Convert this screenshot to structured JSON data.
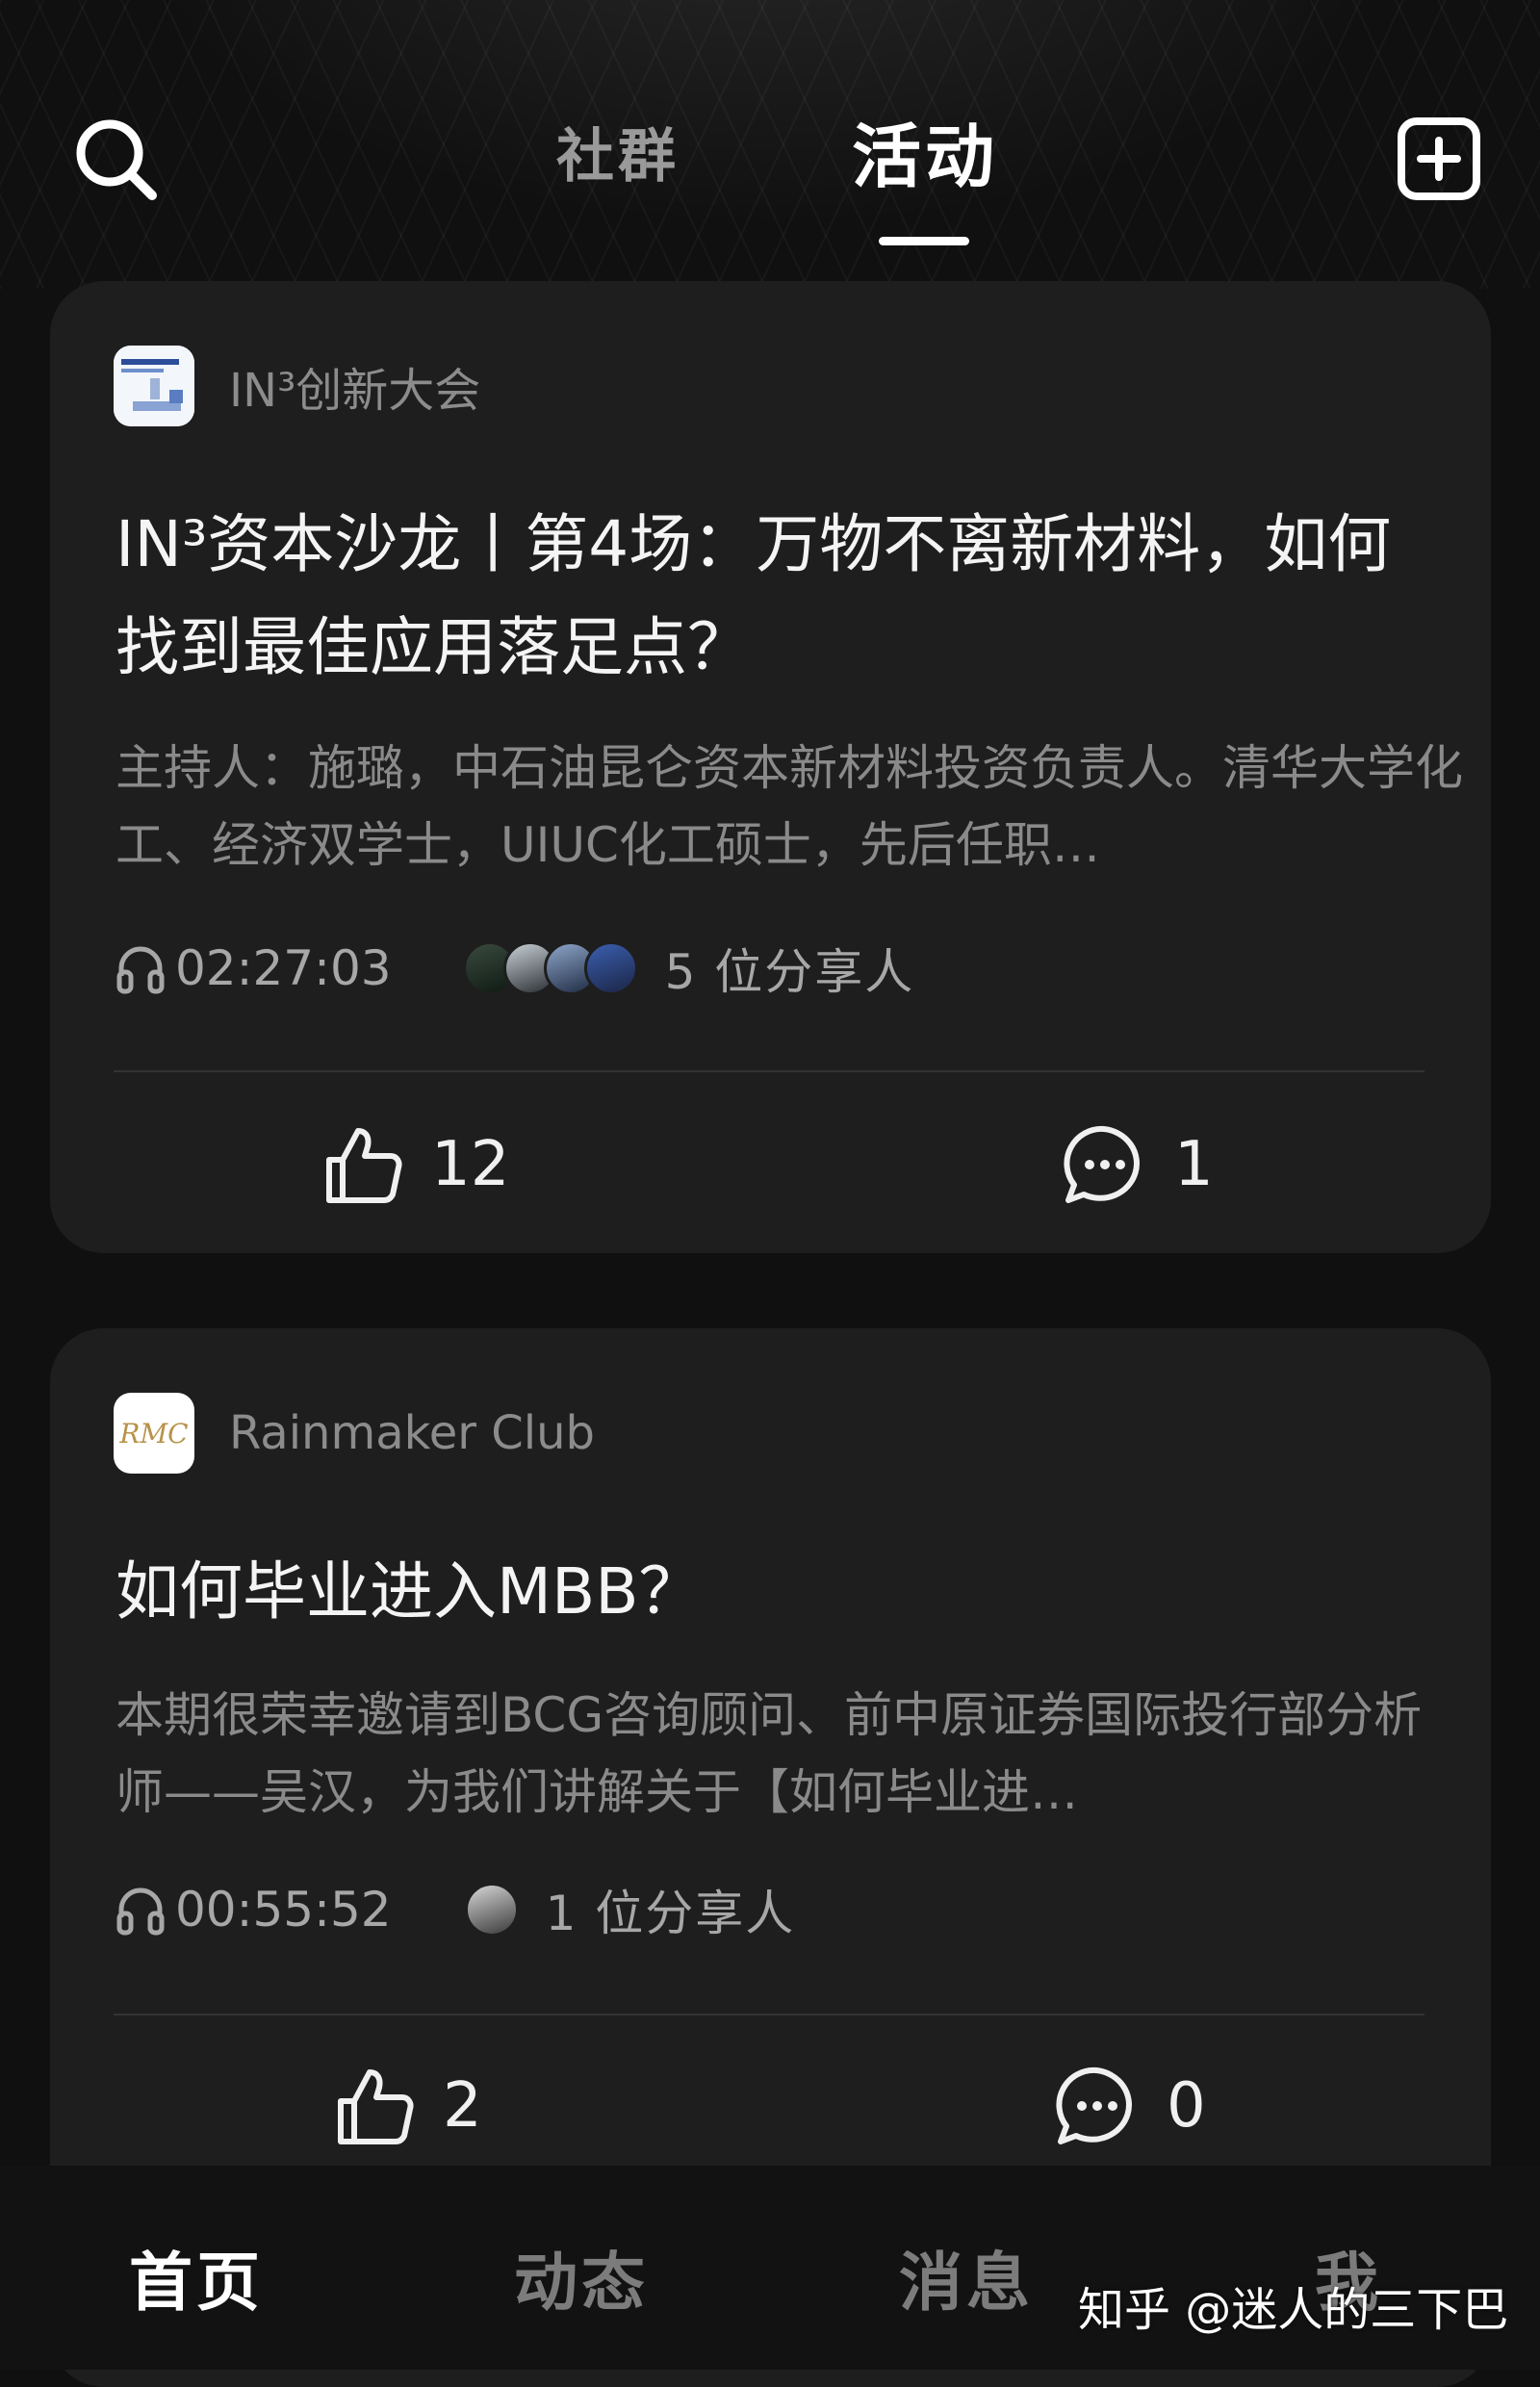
{
  "header": {
    "tabs": [
      {
        "label": "社群",
        "active": false
      },
      {
        "label": "活动",
        "active": true
      }
    ],
    "search_icon": "search-icon",
    "add_icon": "add-square-icon"
  },
  "cards": [
    {
      "club_name": "IN³创新大会",
      "title": "IN³资本沙龙丨第4场：万物不离新材料，如何找到最佳应用落足点？",
      "description": "主持人：施璐，中石油昆仑资本新材料投资负责人。清华大学化工、经济双学士，UIUC化工硕士，先后任职…",
      "duration": "02:27:03",
      "sharers": "5 位分享人",
      "likes": "12",
      "comments": "1"
    },
    {
      "club_name": "Rainmaker Club",
      "club_logo_text": "RMC",
      "title": "如何毕业进入MBB？",
      "description": "本期很荣幸邀请到BCG咨询顾问、前中原证券国际投行部分析师——吴汉，为我们讲解关于【如何毕业进…",
      "duration": "00:55:52",
      "sharers": "1 位分享人",
      "likes": "2",
      "comments": "0"
    }
  ],
  "bottom_nav": [
    {
      "label": "首页",
      "active": true
    },
    {
      "label": "动态",
      "active": false
    },
    {
      "label": "消息",
      "active": false
    },
    {
      "label": "我",
      "active": false
    }
  ],
  "watermark": "知乎 @迷人的三下巴",
  "colors": {
    "background": "#101010",
    "card": "#1e1e1e",
    "text_primary": "#f4f4f4",
    "text_secondary": "#8a8a8a",
    "nav_inactive": "#7c7c7c"
  }
}
